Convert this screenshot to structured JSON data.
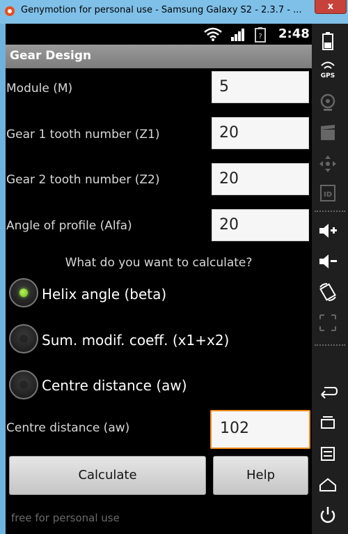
{
  "window": {
    "title": "Genymotion for personal use - Samsung Galaxy S2 - 2.3.7 - ...",
    "close_glyph": "x"
  },
  "status_bar": {
    "time": "2:48",
    "icons": [
      "wifi-icon",
      "signal-icon",
      "battery-icon"
    ]
  },
  "app": {
    "title": "Gear Design"
  },
  "fields": {
    "module": {
      "label": "Module (M)",
      "value": "5"
    },
    "z1": {
      "label": "Gear 1 tooth number (Z1)",
      "value": "20"
    },
    "z2": {
      "label": "Gear 2 tooth number (Z2)",
      "value": "20"
    },
    "alfa": {
      "label": "Angle of profile (Alfa)",
      "value": "20"
    }
  },
  "question": "What do you want to calculate?",
  "options": [
    {
      "label": "Helix angle (beta)",
      "checked": true
    },
    {
      "label": "Sum. modif. coeff. (x1+x2)",
      "checked": false
    },
    {
      "label": "Centre distance (aw)",
      "checked": false
    }
  ],
  "result": {
    "label": "Centre distance (aw)",
    "value": "102"
  },
  "buttons": {
    "calculate": "Calculate",
    "help": "Help"
  },
  "footer": "free for personal use",
  "side_panel": {
    "gps_label": "GPS",
    "id_label": "ID",
    "icons": [
      "battery-widget-icon",
      "gps-icon",
      "camera-icon",
      "video-icon",
      "dpad-icon",
      "id-icon",
      "volume-up-icon",
      "volume-down-icon",
      "rotate-icon",
      "scale-icon",
      "back-icon",
      "recent-apps-icon",
      "menu-icon",
      "home-icon",
      "power-icon"
    ]
  },
  "colors": {
    "focus": "#f08a1a",
    "radio_checked": "#8cd030",
    "title_bar": "#7fc0e8",
    "app_bar": "#8a8a8a"
  }
}
